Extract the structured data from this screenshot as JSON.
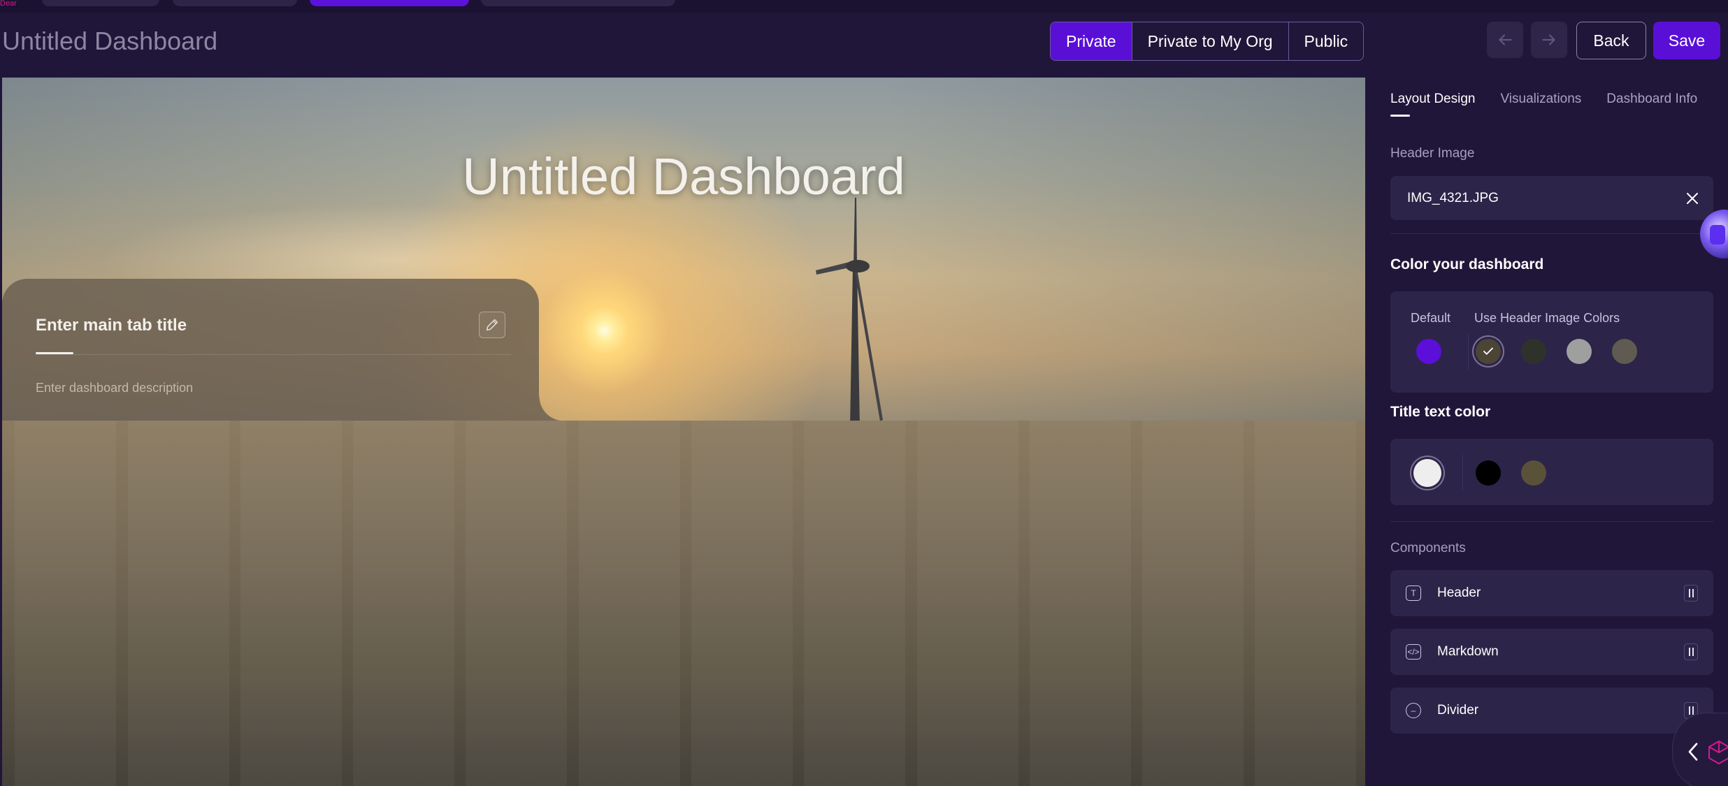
{
  "app": {
    "logo_text": "Dear",
    "page_title": "Untitled Dashboard"
  },
  "visibility": {
    "options": [
      "Private",
      "Private to My Org",
      "Public"
    ],
    "selected": "Private"
  },
  "actions": {
    "back_label": "Back",
    "save_label": "Save",
    "undo_icon": "arrow-left-icon",
    "redo_icon": "arrow-right-icon"
  },
  "canvas": {
    "hero_title": "Untitled Dashboard",
    "main_tab_title_placeholder": "Enter main tab title",
    "description_placeholder": "Enter dashboard description"
  },
  "panel": {
    "tabs": [
      "Layout Design",
      "Visualizations",
      "Dashboard Info"
    ],
    "active_tab": "Layout Design",
    "header_image_label": "Header Image",
    "header_image_file": "IMG_4321.JPG",
    "color_heading": "Color your dashboard",
    "default_label": "Default",
    "header_colors_label": "Use Header Image Colors",
    "default_color": "#5b0fd8",
    "header_image_colors": [
      "#4c4536",
      "#2f322b",
      "#9ea0a0",
      "#5f5b52"
    ],
    "selected_header_color": "#4c4536",
    "title_color_heading": "Title text color",
    "title_colors": [
      "#eeeeee",
      "#000000",
      "#5a5238"
    ],
    "selected_title_color": "#eeeeee",
    "components_label": "Components",
    "components": [
      {
        "label": "Header",
        "icon": "text-icon"
      },
      {
        "label": "Markdown",
        "icon": "code-icon"
      },
      {
        "label": "Divider",
        "icon": "divider-icon"
      }
    ]
  },
  "colors": {
    "accent": "#5a0fd7",
    "background": "#201639",
    "panel_surface": "#2d2449"
  }
}
